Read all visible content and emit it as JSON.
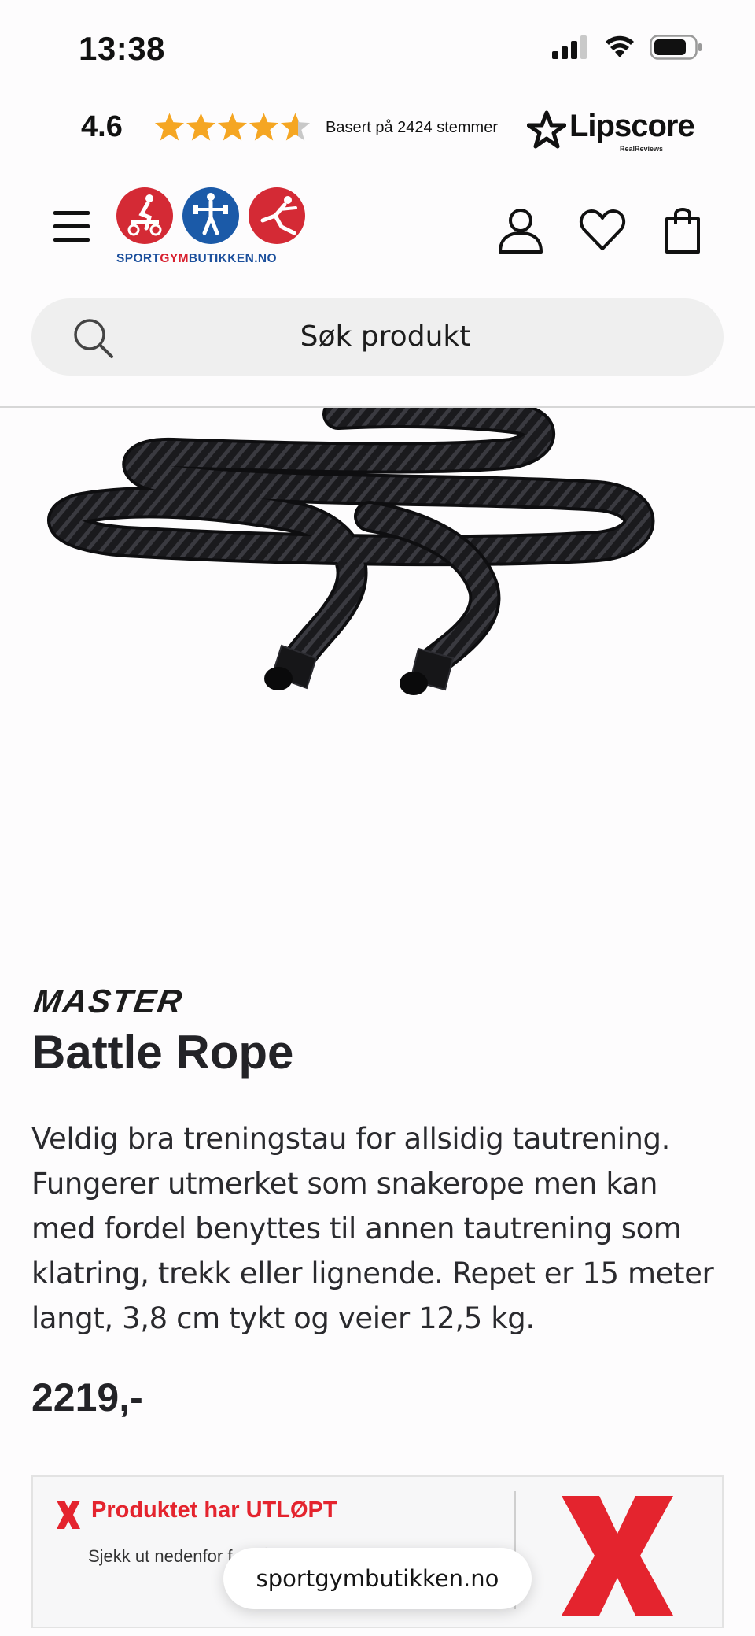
{
  "status_bar": {
    "time": "13:38",
    "icons": [
      "cellular-signal-icon",
      "wifi-icon",
      "battery-icon"
    ]
  },
  "lipscore": {
    "rating": "4.6",
    "stars_filled_fraction": 0.92,
    "votes_text": "Basert på 2424 stemmer",
    "logo_text": "Lipscore",
    "logo_subtext": "RealReviews",
    "star_color": "#f5a623"
  },
  "header": {
    "brand": {
      "part1": "SPORT",
      "part2": "GYM",
      "part3": "BUTIKKEN.NO"
    },
    "icons": [
      "menu-icon",
      "account-icon",
      "heart-icon",
      "shopping-bag-icon"
    ]
  },
  "search": {
    "placeholder": "Søk produkt"
  },
  "product": {
    "brand": "MASTER",
    "title": "Battle Rope",
    "description": "Veldig bra treningstau for allsidig tautrening. Fungerer utmerket som snakerope men kan med fordel benyttes til annen tautrening som klatring, trekk eller lignende. Repet er 15 meter langt, 3,8 cm tykt og veier 12,5 kg.",
    "price": "2219,-"
  },
  "expired_banner": {
    "title": "Produktet har UTLØPT",
    "subtitle": "Sjekk ut nedenfor f... nåværende sortir...",
    "accent_color": "#e4242e"
  },
  "browser": {
    "url": "sportgymbutikken.no"
  }
}
